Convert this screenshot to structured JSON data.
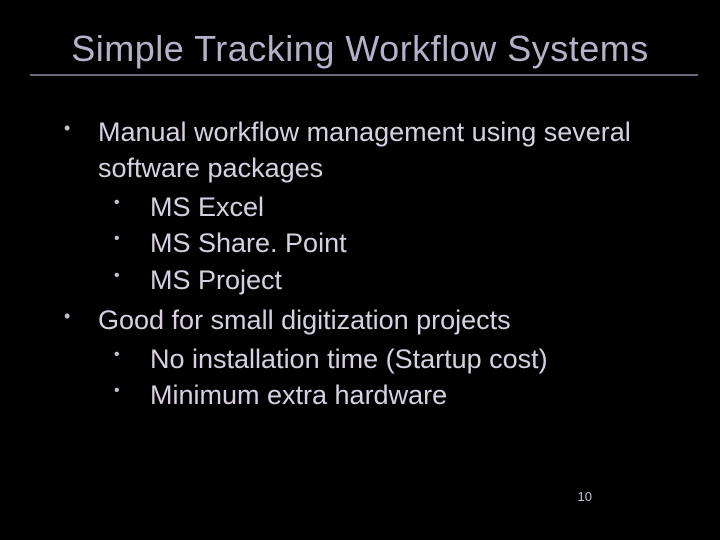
{
  "title": "Simple Tracking Workflow Systems",
  "bullets": [
    {
      "text": "Manual workflow management using several software packages",
      "children": [
        "MS Excel",
        "MS Share. Point",
        "MS Project"
      ]
    },
    {
      "text": "Good for small digitization projects",
      "children": [
        "No installation time (Startup cost)",
        "Minimum extra hardware"
      ]
    }
  ],
  "pageNumber": "10"
}
